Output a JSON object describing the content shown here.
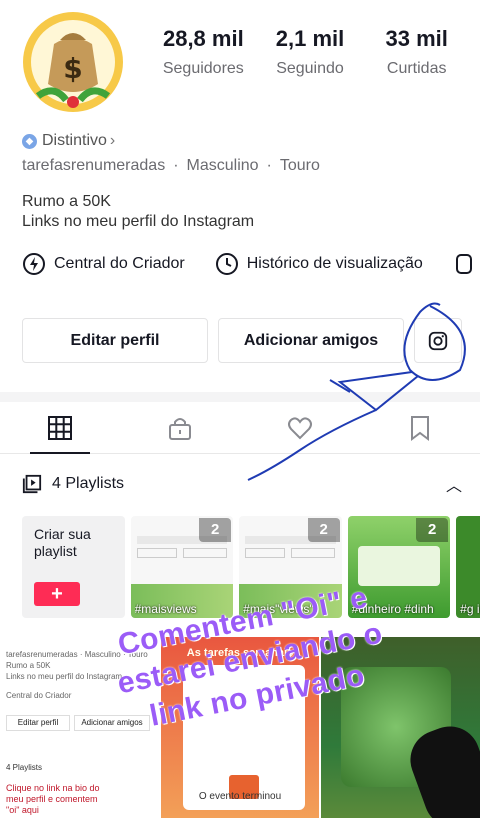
{
  "profile": {
    "stats": [
      {
        "value": "28,8 mil",
        "label": "Seguidores"
      },
      {
        "value": "2,1 mil",
        "label": "Seguindo"
      },
      {
        "value": "33 mil",
        "label": "Curtidas"
      }
    ],
    "badge_label": "Distintivo",
    "meta": [
      "tarefasrenumeradas",
      "·",
      "Masculino",
      "·",
      "Touro"
    ],
    "bio_lines": [
      "Rumo a 50K",
      "Links no meu perfil do Instagram"
    ]
  },
  "links": [
    {
      "label": "Central do Criador",
      "icon": "creator-bolt-icon"
    },
    {
      "label": "Histórico de visualização",
      "icon": "clock-icon"
    }
  ],
  "buttons": {
    "edit": "Editar perfil",
    "add_friends": "Adicionar amigos",
    "instagram_icon": "instagram-icon"
  },
  "tabs": [
    {
      "name": "videos-grid-icon",
      "active": true
    },
    {
      "name": "private-lock-icon",
      "active": false
    },
    {
      "name": "liked-heart-icon",
      "active": false
    },
    {
      "name": "favorites-bookmark-icon",
      "active": false
    }
  ],
  "playlists": {
    "header": "4 Playlists",
    "create_label": "Criar sua playlist",
    "cards": [
      {
        "count": "2",
        "caption": "#maisviews"
      },
      {
        "count": "2",
        "caption": "#mais\"views\""
      },
      {
        "count": "2",
        "caption": "#dinheiro #dinh"
      },
      {
        "count": "",
        "caption": "#g iro"
      }
    ]
  },
  "grid": {
    "mini_profile": [
      "tarefasrenumeradas · Masculino · Touro",
      "Rumo a 50K",
      "Links no meu perfil do Instagram"
    ],
    "mini_buttons": [
      "Editar perfil",
      "Adicionar amigos"
    ],
    "mini_links": [
      "Central do Criador"
    ],
    "mini_playlists": "4 Playlists",
    "caption_1": "Clique no link na bio do meu perfil e comentem \"oi\" aqui",
    "event_header": "As tarefas semanais",
    "event_ended": "O evento terminou"
  },
  "overlay": {
    "text": "Comentem \"Oi\" e estarei enviando o link no privado",
    "color": "#9b5cf7"
  },
  "colors": {
    "accent": "#fe2c55",
    "scribble": "#1f3bb3"
  }
}
